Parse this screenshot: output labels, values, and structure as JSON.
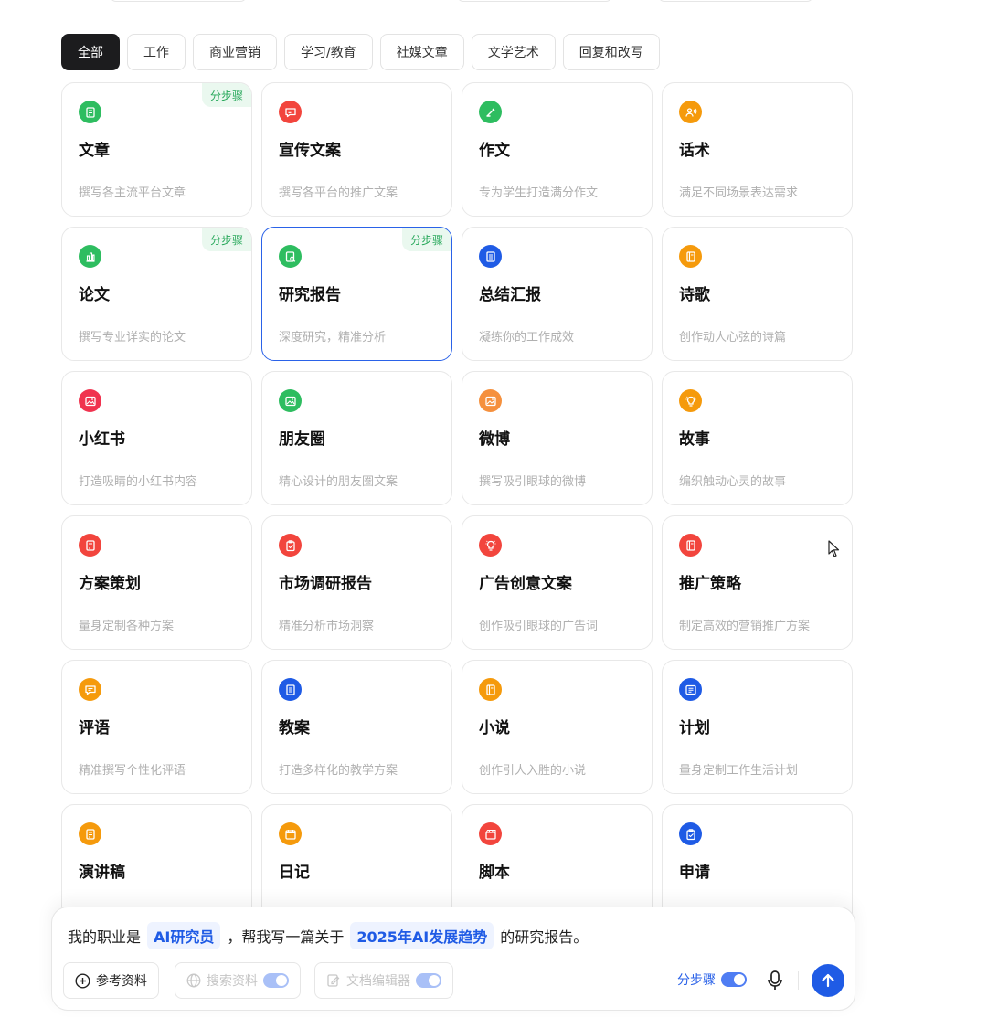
{
  "tabs": [
    {
      "label": "全部",
      "active": true
    },
    {
      "label": "工作",
      "active": false
    },
    {
      "label": "商业营销",
      "active": false
    },
    {
      "label": "学习/教育",
      "active": false
    },
    {
      "label": "社媒文章",
      "active": false
    },
    {
      "label": "文学艺术",
      "active": false
    },
    {
      "label": "回复和改写",
      "active": false
    }
  ],
  "cards": [
    {
      "title": "文章",
      "desc": "撰写各主流平台文章",
      "badge": "分步骤",
      "icon": "document-icon",
      "color": "#2ebd60"
    },
    {
      "title": "宣传文案",
      "desc": "撰写各平台的推广文案",
      "badge": "",
      "icon": "chat-bubble-icon",
      "color": "#f2453d"
    },
    {
      "title": "作文",
      "desc": "专为学生打造满分作文",
      "badge": "",
      "icon": "pen-icon",
      "color": "#2ebd60"
    },
    {
      "title": "话术",
      "desc": "满足不同场景表达需求",
      "badge": "",
      "icon": "speaker-person-icon",
      "color": "#f59a0c"
    },
    {
      "title": "论文",
      "desc": "撰写专业详实的论文",
      "badge": "分步骤",
      "icon": "bar-chart-icon",
      "color": "#2ebd60"
    },
    {
      "title": "研究报告",
      "desc": "深度研究，精准分析",
      "badge": "分步骤",
      "icon": "report-search-icon",
      "color": "#2ebd60",
      "selected": true
    },
    {
      "title": "总结汇报",
      "desc": "凝练你的工作成效",
      "badge": "",
      "icon": "notebook-icon",
      "color": "#1f5be5"
    },
    {
      "title": "诗歌",
      "desc": "创作动人心弦的诗篇",
      "badge": "",
      "icon": "book-icon",
      "color": "#f59a0c"
    },
    {
      "title": "小红书",
      "desc": "打造吸睛的小红书内容",
      "badge": "",
      "icon": "image-icon",
      "color": "#f0334f"
    },
    {
      "title": "朋友圈",
      "desc": "精心设计的朋友圈文案",
      "badge": "",
      "icon": "image-icon",
      "color": "#2ebd60"
    },
    {
      "title": "微博",
      "desc": "撰写吸引眼球的微博",
      "badge": "",
      "icon": "image-icon",
      "color": "#f5903d"
    },
    {
      "title": "故事",
      "desc": "编织触动心灵的故事",
      "badge": "",
      "icon": "lightbulb-icon",
      "color": "#f59a0c"
    },
    {
      "title": "方案策划",
      "desc": "量身定制各种方案",
      "badge": "",
      "icon": "document-icon",
      "color": "#f2453d"
    },
    {
      "title": "市场调研报告",
      "desc": "精准分析市场洞察",
      "badge": "",
      "icon": "clipboard-icon",
      "color": "#f2453d"
    },
    {
      "title": "广告创意文案",
      "desc": "创作吸引眼球的广告词",
      "badge": "",
      "icon": "lightbulb-icon",
      "color": "#f2453d"
    },
    {
      "title": "推广策略",
      "desc": "制定高效的营销推广方案",
      "badge": "",
      "icon": "book-icon",
      "color": "#f2453d"
    },
    {
      "title": "评语",
      "desc": "精准撰写个性化评语",
      "badge": "",
      "icon": "chat-bubble-icon",
      "color": "#f59a0c"
    },
    {
      "title": "教案",
      "desc": "打造多样化的教学方案",
      "badge": "",
      "icon": "notebook-icon",
      "color": "#1f5be5"
    },
    {
      "title": "小说",
      "desc": "创作引人入胜的小说",
      "badge": "",
      "icon": "book-icon",
      "color": "#f59a0c"
    },
    {
      "title": "计划",
      "desc": "量身定制工作生活计划",
      "badge": "",
      "icon": "list-icon",
      "color": "#1f5be5"
    },
    {
      "title": "演讲稿",
      "desc": "",
      "badge": "",
      "icon": "document-icon",
      "color": "#f59a0c"
    },
    {
      "title": "日记",
      "desc": "",
      "badge": "",
      "icon": "calendar-icon",
      "color": "#f59a0c"
    },
    {
      "title": "脚本",
      "desc": "",
      "badge": "",
      "icon": "clapperboard-icon",
      "color": "#f2453d"
    },
    {
      "title": "申请",
      "desc": "",
      "badge": "",
      "icon": "clipboard-icon",
      "color": "#1f5be5"
    }
  ],
  "composer": {
    "prefix": "我的职业是",
    "chip1": "AI研究员",
    "middle": "，帮我写一篇关于",
    "chip2": "2025年AI发展趋势",
    "suffix": "的研究报告。",
    "reference_label": "参考资料",
    "search_label": "搜索资料",
    "editor_label": "文档编辑器",
    "step_label": "分步骤"
  },
  "colors": {
    "accent": "#1f5be5",
    "active_tab": "#1c1c1e",
    "badge_text": "#27a85a"
  }
}
